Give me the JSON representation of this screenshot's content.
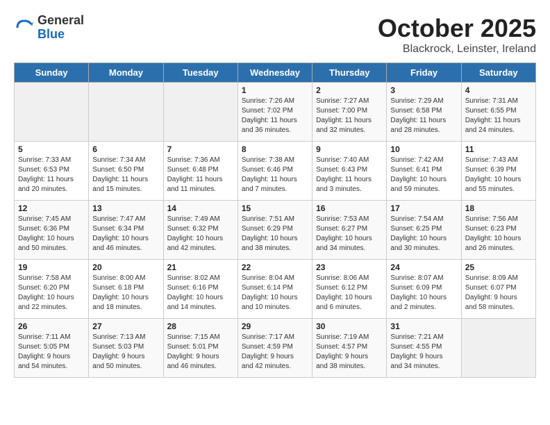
{
  "logo": {
    "general": "General",
    "blue": "Blue"
  },
  "title": "October 2025",
  "subtitle": "Blackrock, Leinster, Ireland",
  "days_of_week": [
    "Sunday",
    "Monday",
    "Tuesday",
    "Wednesday",
    "Thursday",
    "Friday",
    "Saturday"
  ],
  "weeks": [
    [
      {
        "day": "",
        "info": ""
      },
      {
        "day": "",
        "info": ""
      },
      {
        "day": "",
        "info": ""
      },
      {
        "day": "1",
        "info": "Sunrise: 7:26 AM\nSunset: 7:02 PM\nDaylight: 11 hours\nand 36 minutes."
      },
      {
        "day": "2",
        "info": "Sunrise: 7:27 AM\nSunset: 7:00 PM\nDaylight: 11 hours\nand 32 minutes."
      },
      {
        "day": "3",
        "info": "Sunrise: 7:29 AM\nSunset: 6:58 PM\nDaylight: 11 hours\nand 28 minutes."
      },
      {
        "day": "4",
        "info": "Sunrise: 7:31 AM\nSunset: 6:55 PM\nDaylight: 11 hours\nand 24 minutes."
      }
    ],
    [
      {
        "day": "5",
        "info": "Sunrise: 7:33 AM\nSunset: 6:53 PM\nDaylight: 11 hours\nand 20 minutes."
      },
      {
        "day": "6",
        "info": "Sunrise: 7:34 AM\nSunset: 6:50 PM\nDaylight: 11 hours\nand 15 minutes."
      },
      {
        "day": "7",
        "info": "Sunrise: 7:36 AM\nSunset: 6:48 PM\nDaylight: 11 hours\nand 11 minutes."
      },
      {
        "day": "8",
        "info": "Sunrise: 7:38 AM\nSunset: 6:46 PM\nDaylight: 11 hours\nand 7 minutes."
      },
      {
        "day": "9",
        "info": "Sunrise: 7:40 AM\nSunset: 6:43 PM\nDaylight: 11 hours\nand 3 minutes."
      },
      {
        "day": "10",
        "info": "Sunrise: 7:42 AM\nSunset: 6:41 PM\nDaylight: 10 hours\nand 59 minutes."
      },
      {
        "day": "11",
        "info": "Sunrise: 7:43 AM\nSunset: 6:39 PM\nDaylight: 10 hours\nand 55 minutes."
      }
    ],
    [
      {
        "day": "12",
        "info": "Sunrise: 7:45 AM\nSunset: 6:36 PM\nDaylight: 10 hours\nand 50 minutes."
      },
      {
        "day": "13",
        "info": "Sunrise: 7:47 AM\nSunset: 6:34 PM\nDaylight: 10 hours\nand 46 minutes."
      },
      {
        "day": "14",
        "info": "Sunrise: 7:49 AM\nSunset: 6:32 PM\nDaylight: 10 hours\nand 42 minutes."
      },
      {
        "day": "15",
        "info": "Sunrise: 7:51 AM\nSunset: 6:29 PM\nDaylight: 10 hours\nand 38 minutes."
      },
      {
        "day": "16",
        "info": "Sunrise: 7:53 AM\nSunset: 6:27 PM\nDaylight: 10 hours\nand 34 minutes."
      },
      {
        "day": "17",
        "info": "Sunrise: 7:54 AM\nSunset: 6:25 PM\nDaylight: 10 hours\nand 30 minutes."
      },
      {
        "day": "18",
        "info": "Sunrise: 7:56 AM\nSunset: 6:23 PM\nDaylight: 10 hours\nand 26 minutes."
      }
    ],
    [
      {
        "day": "19",
        "info": "Sunrise: 7:58 AM\nSunset: 6:20 PM\nDaylight: 10 hours\nand 22 minutes."
      },
      {
        "day": "20",
        "info": "Sunrise: 8:00 AM\nSunset: 6:18 PM\nDaylight: 10 hours\nand 18 minutes."
      },
      {
        "day": "21",
        "info": "Sunrise: 8:02 AM\nSunset: 6:16 PM\nDaylight: 10 hours\nand 14 minutes."
      },
      {
        "day": "22",
        "info": "Sunrise: 8:04 AM\nSunset: 6:14 PM\nDaylight: 10 hours\nand 10 minutes."
      },
      {
        "day": "23",
        "info": "Sunrise: 8:06 AM\nSunset: 6:12 PM\nDaylight: 10 hours\nand 6 minutes."
      },
      {
        "day": "24",
        "info": "Sunrise: 8:07 AM\nSunset: 6:09 PM\nDaylight: 10 hours\nand 2 minutes."
      },
      {
        "day": "25",
        "info": "Sunrise: 8:09 AM\nSunset: 6:07 PM\nDaylight: 9 hours\nand 58 minutes."
      }
    ],
    [
      {
        "day": "26",
        "info": "Sunrise: 7:11 AM\nSunset: 5:05 PM\nDaylight: 9 hours\nand 54 minutes."
      },
      {
        "day": "27",
        "info": "Sunrise: 7:13 AM\nSunset: 5:03 PM\nDaylight: 9 hours\nand 50 minutes."
      },
      {
        "day": "28",
        "info": "Sunrise: 7:15 AM\nSunset: 5:01 PM\nDaylight: 9 hours\nand 46 minutes."
      },
      {
        "day": "29",
        "info": "Sunrise: 7:17 AM\nSunset: 4:59 PM\nDaylight: 9 hours\nand 42 minutes."
      },
      {
        "day": "30",
        "info": "Sunrise: 7:19 AM\nSunset: 4:57 PM\nDaylight: 9 hours\nand 38 minutes."
      },
      {
        "day": "31",
        "info": "Sunrise: 7:21 AM\nSunset: 4:55 PM\nDaylight: 9 hours\nand 34 minutes."
      },
      {
        "day": "",
        "info": ""
      }
    ]
  ]
}
